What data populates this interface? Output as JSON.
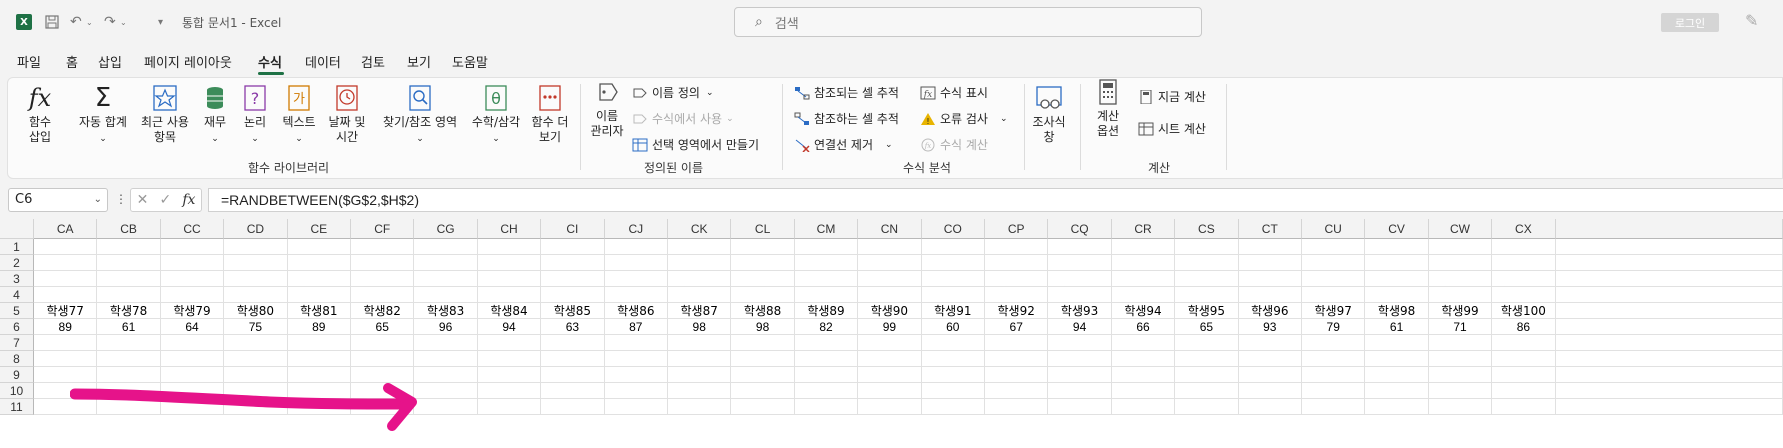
{
  "titlebar": {
    "app_icon": "excel-logo",
    "doc_title": "통합 문서1  -  Excel",
    "search_placeholder": "검색",
    "login_label": "로그인"
  },
  "menu": {
    "tabs": [
      "파일",
      "홈",
      "삽입",
      "페이지 레이아웃",
      "수식",
      "데이터",
      "검토",
      "보기",
      "도움말"
    ],
    "active_tab": "수식"
  },
  "ribbon": {
    "insert_function": "함수\n삽입",
    "autosum": "자동 합계",
    "recent": "최근 사용\n항목",
    "financial": "재무",
    "logical": "논리",
    "text": "텍스트",
    "datetime": "날짜 및\n시간",
    "lookup": "찾기/참조 영역",
    "mathtrig": "수학/삼각",
    "more_functions": "함수 더\n보기",
    "group_function_library": "함수 라이브러리",
    "name_manager": "이름\n관리자",
    "define_name": "이름 정의",
    "use_in_formula": "수식에서 사용",
    "create_from_selection": "선택 영역에서 만들기",
    "group_defined_names": "정의된 이름",
    "trace_precedents": "참조되는 셀 추적",
    "trace_dependents": "참조하는 셀 추적",
    "remove_arrows": "연결선 제거",
    "show_formulas": "수식 표시",
    "error_checking": "오류 검사",
    "evaluate_formula": "수식 계산",
    "group_formula_auditing": "수식 분석",
    "watch_window": "조사식\n창",
    "calc_options": "계산\n옵션",
    "calc_now": "지금 계산",
    "calc_sheet": "시트 계산",
    "group_calculation": "계산"
  },
  "formula_bar": {
    "name_box": "C6",
    "formula": "=RANDBETWEEN($G$2,$H$2)"
  },
  "grid": {
    "columns": [
      "CA",
      "CB",
      "CC",
      "CD",
      "CE",
      "CF",
      "CG",
      "CH",
      "CI",
      "CJ",
      "CK",
      "CL",
      "CM",
      "CN",
      "CO",
      "CP",
      "CQ",
      "CR",
      "CS",
      "CT",
      "CU",
      "CV",
      "CW",
      "CX"
    ],
    "rows": [
      "1",
      "2",
      "3",
      "4",
      "5",
      "6",
      "7",
      "8",
      "9",
      "10",
      "11"
    ],
    "row5": [
      "학생77",
      "학생78",
      "학생79",
      "학생80",
      "학생81",
      "학생82",
      "학생83",
      "학생84",
      "학생85",
      "학생86",
      "학생87",
      "학생88",
      "학생89",
      "학생90",
      "학생91",
      "학생92",
      "학생93",
      "학생94",
      "학생95",
      "학생96",
      "학생97",
      "학생98",
      "학생99",
      "학생100"
    ],
    "row6": [
      "89",
      "61",
      "64",
      "75",
      "89",
      "65",
      "96",
      "94",
      "63",
      "87",
      "98",
      "98",
      "82",
      "99",
      "60",
      "67",
      "94",
      "66",
      "65",
      "93",
      "79",
      "61",
      "71",
      "86"
    ]
  },
  "annotation": {
    "arrow_color": "#e6138a",
    "arrow_direction": "right"
  }
}
